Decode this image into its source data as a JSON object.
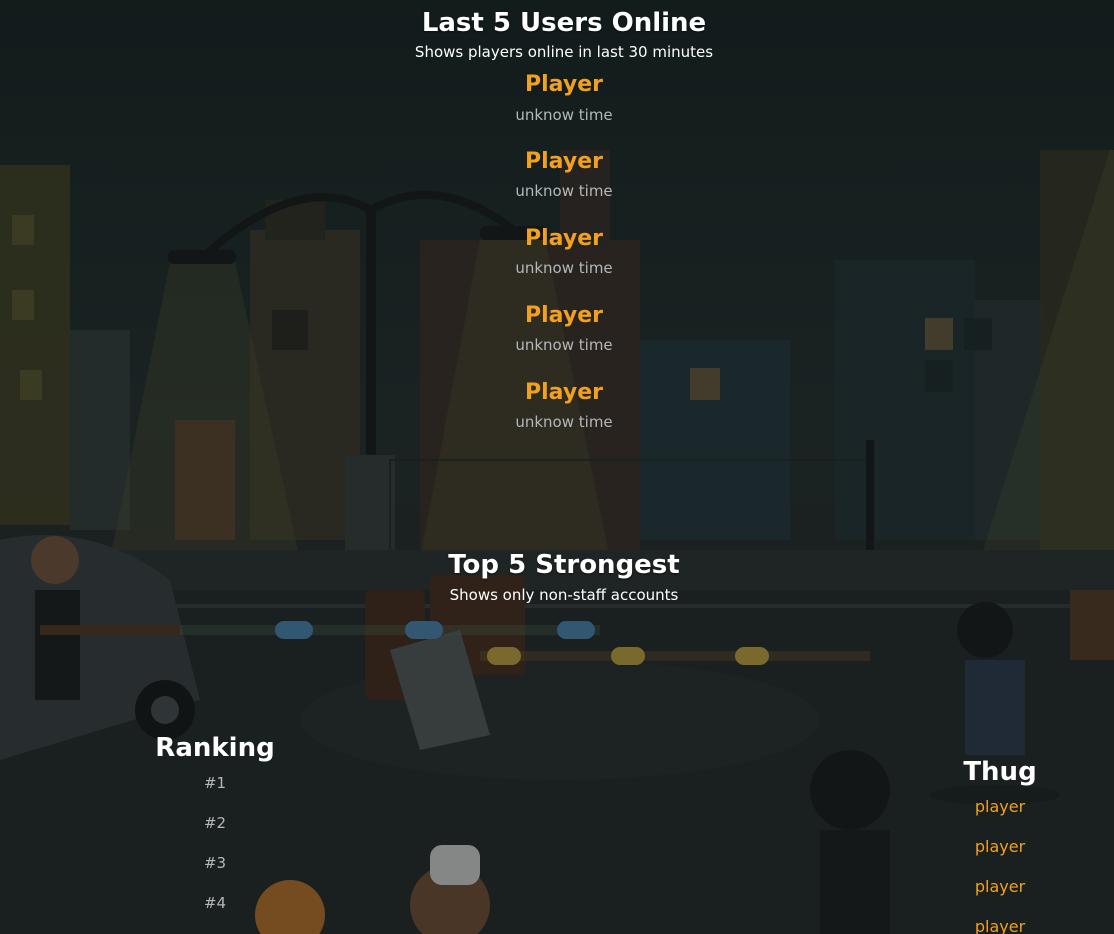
{
  "online": {
    "title": "Last 5 Users Online",
    "subtitle": "Shows players online in last 30 minutes",
    "users": [
      {
        "name": "Player",
        "time": "unknow time"
      },
      {
        "name": "Player",
        "time": "unknow time"
      },
      {
        "name": "Player",
        "time": "unknow time"
      },
      {
        "name": "Player",
        "time": "unknow time"
      },
      {
        "name": "Player",
        "time": "unknow time"
      }
    ]
  },
  "strongest": {
    "title": "Top 5 Strongest",
    "subtitle": "Shows only non-staff accounts",
    "ranking": {
      "header": "Ranking",
      "items": [
        "#1",
        "#2",
        "#3",
        "#4"
      ]
    },
    "thug": {
      "header": "Thug",
      "items": [
        "player",
        "player",
        "player",
        "player"
      ]
    }
  },
  "colors": {
    "accent": "#f1a11f",
    "muted": "#b4b8b9",
    "heading": "#ffffff"
  }
}
